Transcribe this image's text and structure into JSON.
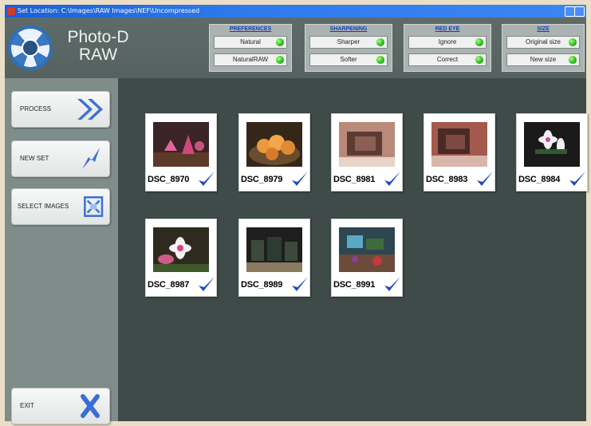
{
  "window": {
    "title": "Set Location: C:\\Images\\RAW Images\\NEF\\Uncompressed"
  },
  "app": {
    "brand_line1": "Photo-D",
    "brand_line2": "RAW"
  },
  "groups": [
    {
      "title": "PREFERENCES",
      "options": [
        {
          "label": "Natural",
          "led": "on"
        },
        {
          "label": "NaturalRAW",
          "led": "on"
        }
      ]
    },
    {
      "title": "SHARPENING",
      "options": [
        {
          "label": "Sharper",
          "led": "on"
        },
        {
          "label": "Softer",
          "led": "on"
        }
      ]
    },
    {
      "title": "RED EYE",
      "options": [
        {
          "label": "Ignore",
          "led": "on"
        },
        {
          "label": "Correct",
          "led": "on"
        }
      ]
    },
    {
      "title": "SIZE",
      "options": [
        {
          "label": "Original size",
          "led": "on"
        },
        {
          "label": "New size",
          "led": "on"
        }
      ]
    }
  ],
  "sidebar": {
    "process": {
      "label": "PROCESS",
      "icon": "fast-forward-icon"
    },
    "new_set": {
      "label": "NEW SET",
      "icon": "lightning-icon"
    },
    "select_images": {
      "label": "SELECT IMAGES",
      "icon": "image-grid-icon"
    },
    "exit": {
      "label": "EXIT",
      "icon": "close-x-icon"
    }
  },
  "images": [
    {
      "name": "DSC_8970",
      "checked": true
    },
    {
      "name": "DSC_8979",
      "checked": true
    },
    {
      "name": "DSC_8981",
      "checked": true
    },
    {
      "name": "DSC_8983",
      "checked": true
    },
    {
      "name": "DSC_8984",
      "checked": true
    },
    {
      "name": "DSC_8987",
      "checked": true
    },
    {
      "name": "DSC_8989",
      "checked": true
    },
    {
      "name": "DSC_8991",
      "checked": true
    }
  ],
  "colors": {
    "accent": "#1f49c9",
    "led_on": "#27b81a",
    "client_bg": "#4e5a58"
  }
}
